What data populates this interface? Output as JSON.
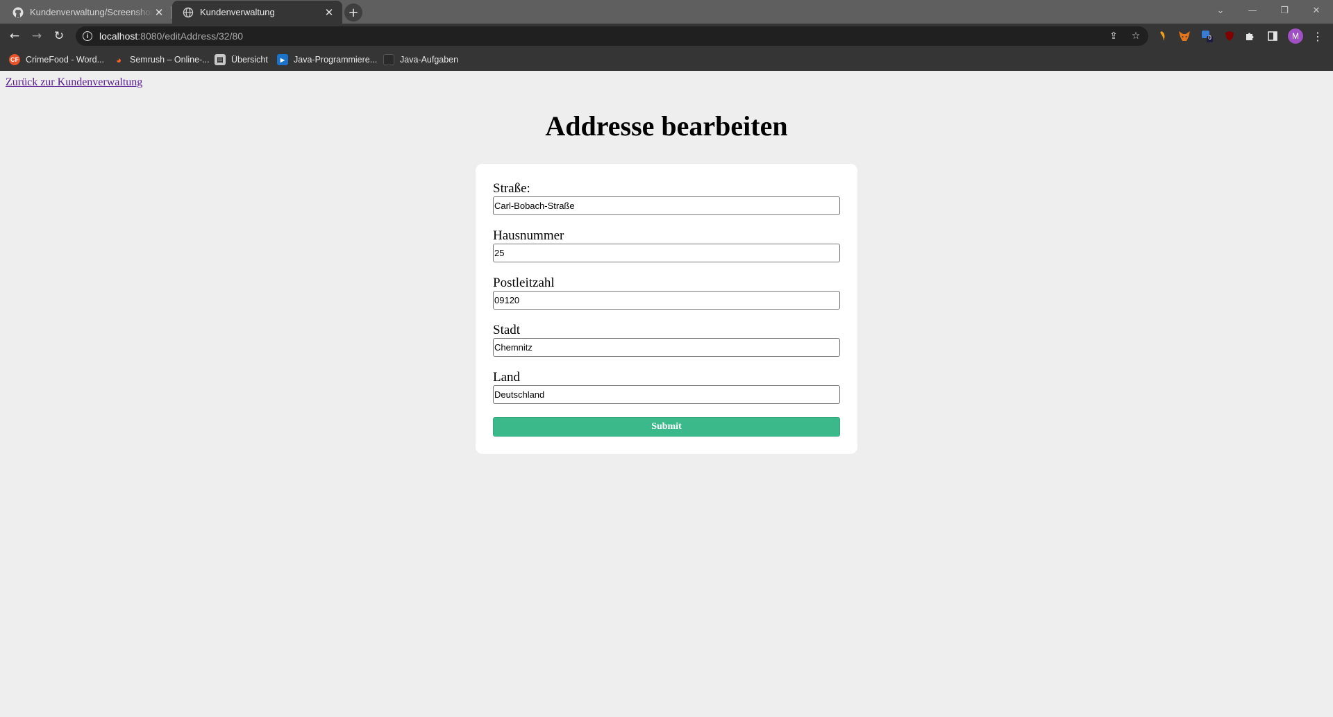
{
  "browser": {
    "tabs": [
      {
        "title": "Kundenverwaltung/Screenshot K",
        "icon": "github-icon",
        "active": false
      },
      {
        "title": "Kundenverwaltung",
        "icon": "globe-icon",
        "active": true
      }
    ],
    "address": {
      "host": "localhost",
      "rest": ":8080/editAddress/32/80"
    },
    "bookmarks": [
      {
        "label": "CrimeFood - Word...",
        "icon": "crimefood-icon"
      },
      {
        "label": "Semrush – Online-...",
        "icon": "semrush-icon"
      },
      {
        "label": "Übersicht",
        "icon": "overview-icon"
      },
      {
        "label": "Java-Programmiere...",
        "icon": "java-video-icon"
      },
      {
        "label": "Java-Aufgaben",
        "icon": "java-tasks-icon"
      }
    ],
    "profile_initial": "M",
    "extension_badge": "0"
  },
  "page": {
    "back_link": "Zurück zur Kundenverwaltung",
    "title": "Addresse bearbeiten",
    "form": {
      "fields": [
        {
          "label": "Straße:",
          "value": "Carl-Bobach-Straße"
        },
        {
          "label": "Hausnummer",
          "value": "25"
        },
        {
          "label": "Postleitzahl",
          "value": "09120"
        },
        {
          "label": "Stadt",
          "value": "Chemnitz"
        },
        {
          "label": "Land",
          "value": "Deutschland"
        }
      ],
      "submit_label": "Submit"
    },
    "colors": {
      "background": "#eeeeee",
      "card": "#ffffff",
      "submit": "#3cb98b",
      "link_visited": "#551a8b"
    }
  }
}
